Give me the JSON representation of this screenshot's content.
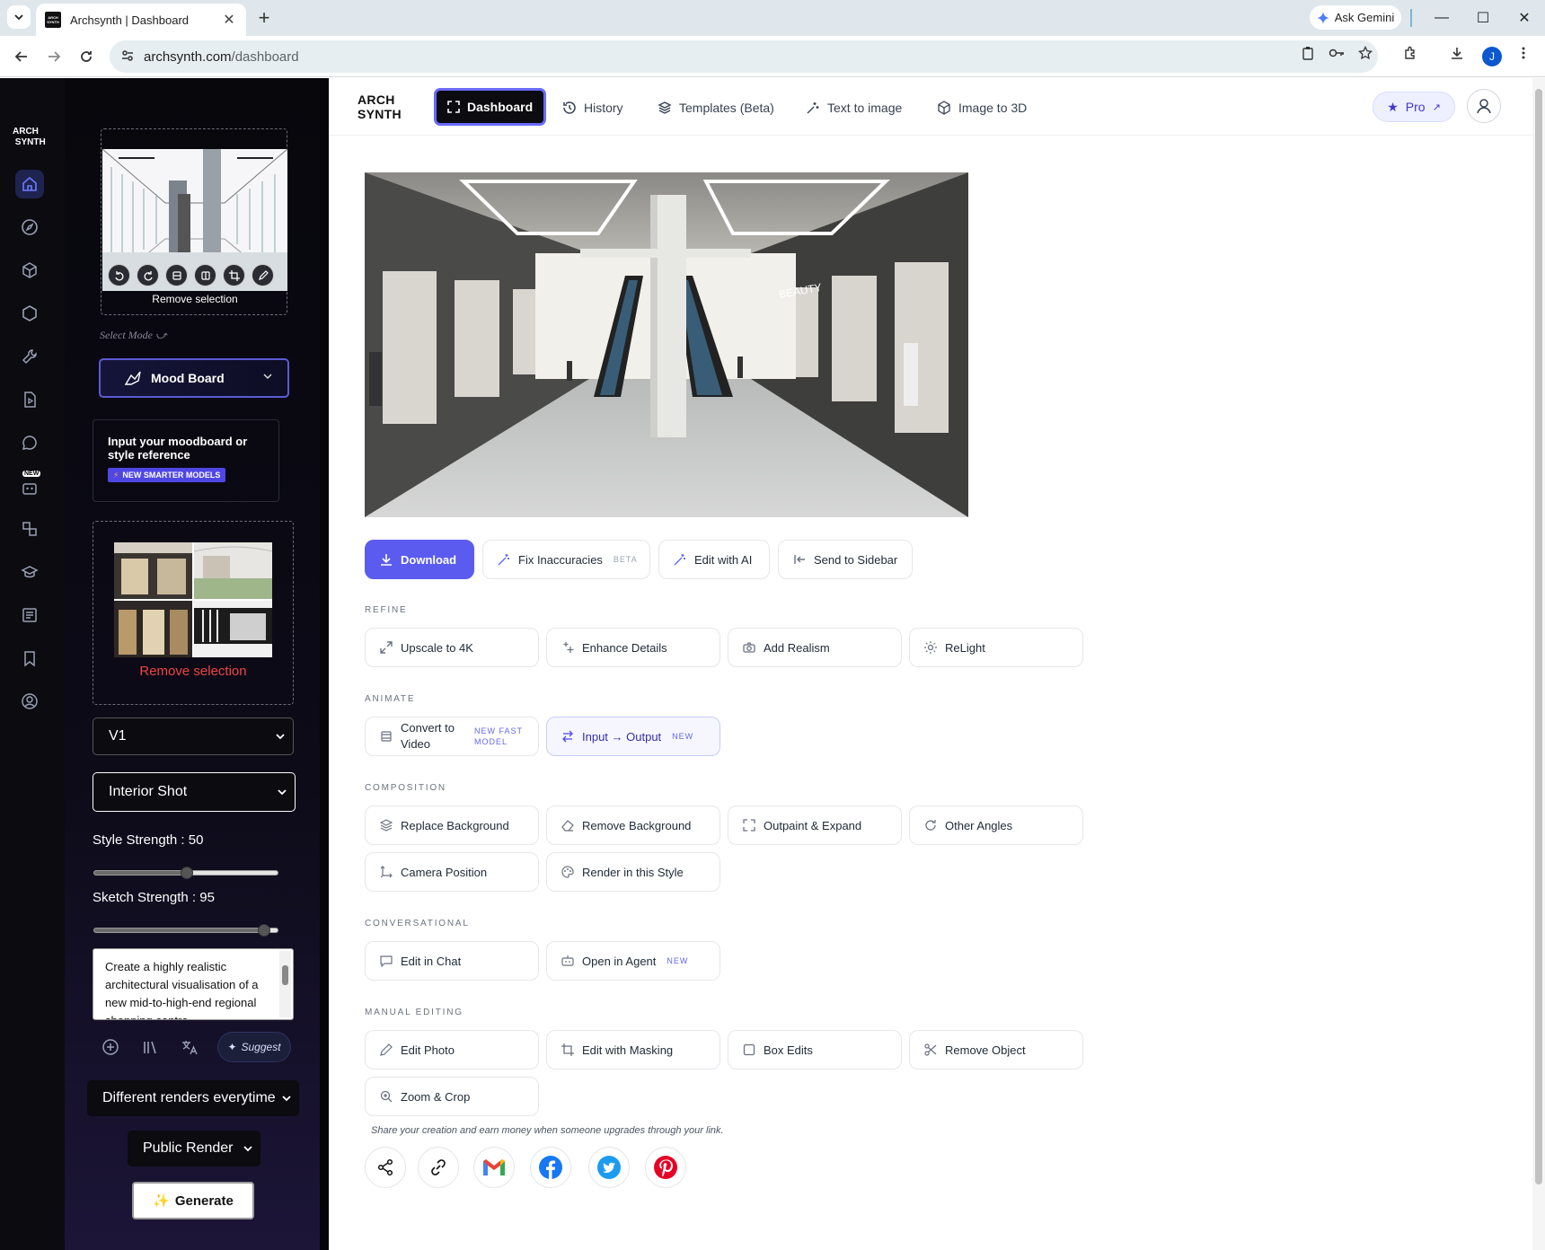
{
  "browser": {
    "tab_title": "Archsynth | Dashboard",
    "url_domain": "archsynth.com",
    "url_path": "/dashboard",
    "gemini_label": "Ask Gemini",
    "profile_initial": "J"
  },
  "rail": {
    "logo": "ARCH\nSYNTH",
    "new_badge": "NEW",
    "icons": [
      "home-icon",
      "compass-icon",
      "cube-icon",
      "hexagon-icon",
      "wrench-icon",
      "video-file-icon",
      "chat-icon",
      "robot-icon",
      "shapes-icon",
      "graduation-cap-icon",
      "newspaper-icon",
      "bookmark-icon",
      "user-circle-icon"
    ]
  },
  "sidebar": {
    "preview_remove_label": "Remove selection",
    "select_mode_label": "Select Mode",
    "mode_button_label": "Mood Board",
    "moodboard_text": "Input your moodboard or style reference",
    "moodboard_tag": "NEW SMARTER MODELS",
    "reference_remove_label": "Remove selection",
    "version_select": "V1",
    "shot_select": "Interior Shot",
    "style_strength_label": "Style Strength : 50",
    "style_strength": 50,
    "sketch_strength_label": "Sketch Strength : 95",
    "sketch_strength": 95,
    "prompt_text": "Create a highly realistic architectural visualisation of a new mid-to-high-end regional shopping centre",
    "suggest_label": "Suggest",
    "variation_select": "Different renders everytime",
    "visibility_select": "Public Render",
    "generate_label": "Generate"
  },
  "topnav": {
    "brand": "ARCH\nSYNTH",
    "links": [
      {
        "label": "Dashboard",
        "icon": "expand-icon"
      },
      {
        "label": "History",
        "icon": "history-icon"
      },
      {
        "label": "Templates (Beta)",
        "icon": "layers-icon"
      },
      {
        "label": "Text to image",
        "icon": "sparkle-wand-icon"
      },
      {
        "label": "Image to 3D",
        "icon": "box-3d-icon"
      }
    ],
    "pro_label": "Pro"
  },
  "actions": {
    "download": "Download",
    "fix": "Fix Inaccuracies",
    "fix_tag": "BETA",
    "edit_ai": "Edit with AI",
    "send_sidebar": "Send to Sidebar"
  },
  "sections": {
    "refine": {
      "title": "REFINE",
      "items": [
        "Upscale to 4K",
        "Enhance Details",
        "Add Realism",
        "ReLight"
      ]
    },
    "animate": {
      "title": "ANIMATE",
      "items": [
        "Convert to Video",
        "Input → Output"
      ],
      "tags": [
        "NEW FAST MODEL",
        "NEW"
      ]
    },
    "composition": {
      "title": "COMPOSITION",
      "items": [
        "Replace Background",
        "Remove Background",
        "Outpaint & Expand",
        "Other Angles",
        "Camera Position",
        "Render in this Style"
      ]
    },
    "conversational": {
      "title": "CONVERSATIONAL",
      "items": [
        "Edit in Chat",
        "Open in Agent"
      ],
      "tags": [
        "NEW"
      ]
    },
    "manual": {
      "title": "MANUAL EDITING",
      "items": [
        "Edit Photo",
        "Edit with Masking",
        "Box Edits",
        "Remove Object",
        "Zoom & Crop"
      ]
    }
  },
  "share": {
    "text": "Share your creation and earn money when someone upgrades through your link.",
    "buttons": [
      "share-icon",
      "link-icon",
      "gmail-icon",
      "facebook-icon",
      "twitter-icon",
      "pinterest-icon"
    ]
  },
  "colors": {
    "accent": "#5b5bf0",
    "sidebar_bg": "#0b0b10",
    "remove_red": "#ef4444",
    "pro_text": "#4338ca"
  }
}
